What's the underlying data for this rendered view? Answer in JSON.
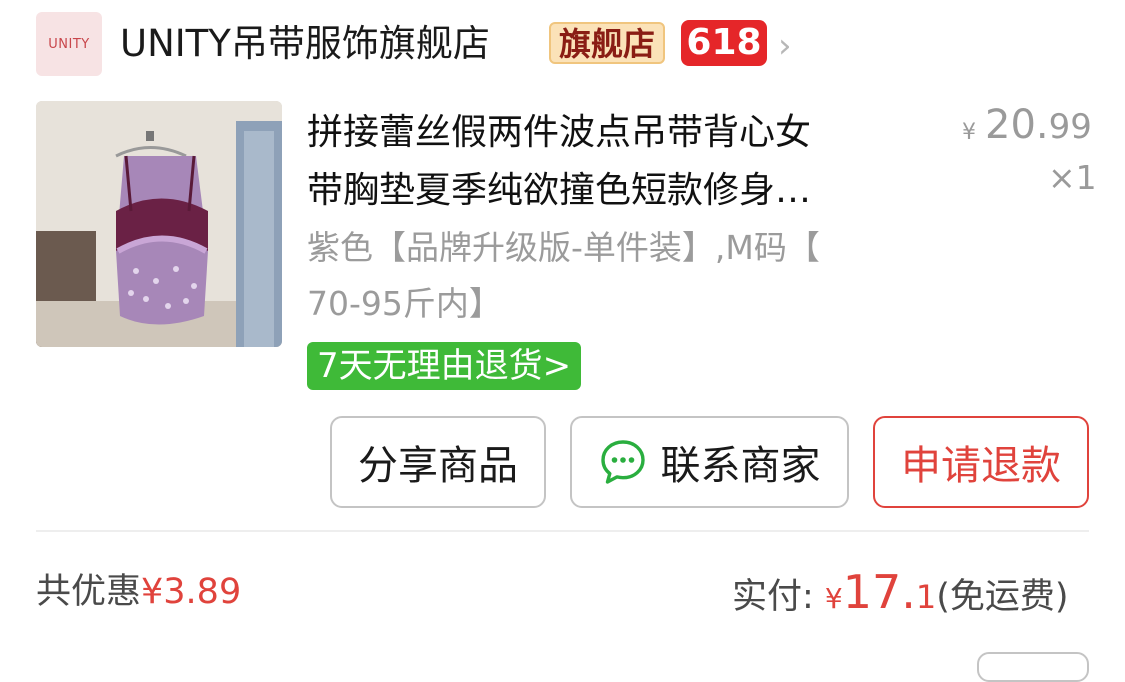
{
  "shop": {
    "logo_text": "UNITY",
    "name": "UNITY吊带服饰旗舰店",
    "badge_flagship": "旗舰店",
    "badge_618": "618"
  },
  "product": {
    "title_line1": "拼接蕾丝假两件波点吊带背心女",
    "title_line2": "带胸垫夏季纯欲撞色短款修身…",
    "price_symbol": "¥",
    "price_int": "20.",
    "price_dec": "99",
    "quantity": "×1",
    "spec_line1": "紫色【品牌升级版-单件装】,M码【",
    "spec_line2": "70-95斤内】",
    "return_tag": "7天无理由退货",
    "return_chevron": ">"
  },
  "actions": {
    "share": "分享商品",
    "contact": "联系商家",
    "refund": "申请退款"
  },
  "summary": {
    "discount_label": "共优惠",
    "discount_amount": "¥3.89",
    "paid_label": "实付: ",
    "paid_symbol": "¥",
    "paid_int": "17.",
    "paid_dec": "1",
    "shipping_note": "(免运费)"
  },
  "icons": {
    "shop_chevron": "›",
    "chat": "chat-bubble-icon"
  },
  "colors": {
    "accent_red": "#e0433c",
    "return_green": "#3fba38",
    "badge_red": "#e52629",
    "flagship_bg": "#fbe2b8"
  }
}
